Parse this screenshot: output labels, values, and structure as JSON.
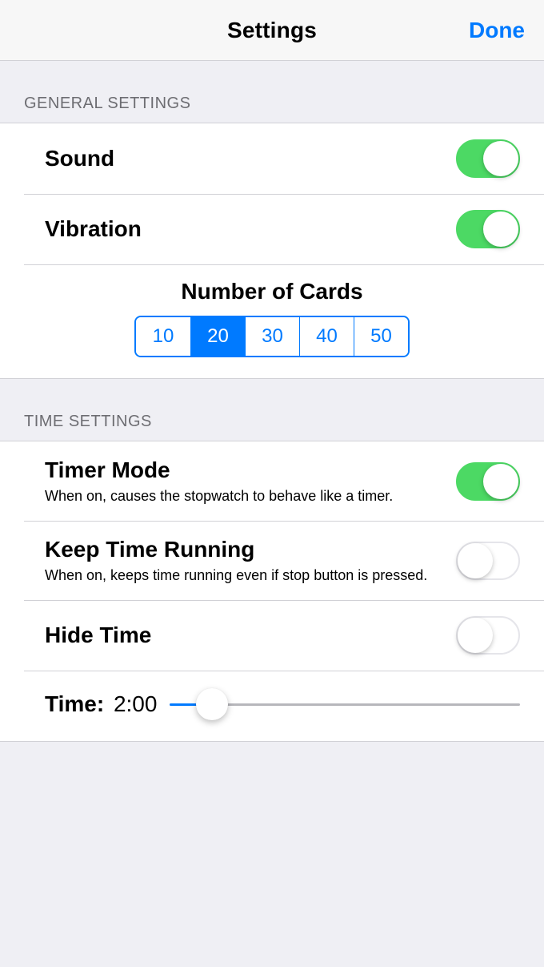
{
  "navbar": {
    "title": "Settings",
    "done": "Done"
  },
  "sections": {
    "general": {
      "header": "GENERAL SETTINGS",
      "sound": {
        "label": "Sound",
        "on": true
      },
      "vibration": {
        "label": "Vibration",
        "on": true
      },
      "cards": {
        "title": "Number of Cards",
        "options": [
          "10",
          "20",
          "30",
          "40",
          "50"
        ],
        "selected": "20"
      }
    },
    "time": {
      "header": "TIME SETTINGS",
      "timer_mode": {
        "label": "Timer Mode",
        "sub": "When on, causes the stopwatch to behave like a timer.",
        "on": true
      },
      "keep_running": {
        "label": "Keep Time Running",
        "sub": "When on, keeps time running even if stop button is pressed.",
        "on": false
      },
      "hide_time": {
        "label": "Hide Time",
        "on": false
      },
      "time_slider": {
        "label": "Time:",
        "value": "2:00",
        "percent": 12
      }
    }
  }
}
